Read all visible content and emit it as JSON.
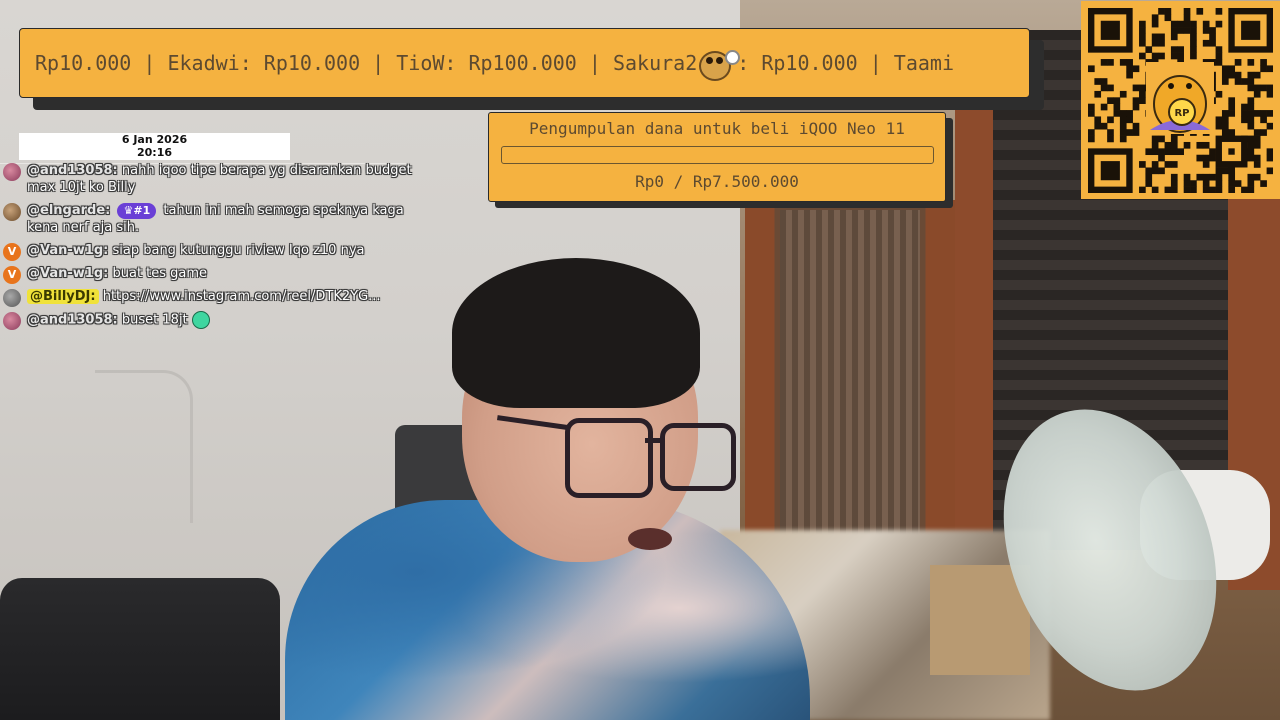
{
  "ticker": {
    "part1": "Rp10.000 | Ekadwi: Rp10.000 | TioW: Rp100.000 | Sakura2",
    "part2": ": Rp10.000 | Taami"
  },
  "timestamp": {
    "date": "6 Jan 2026",
    "time": "20:16"
  },
  "chat": [
    {
      "name": "@and13058:",
      "text": "nahh iqoo tipe berapa yg disarankan budget max 10jt ko Billy",
      "avatar": "pink"
    },
    {
      "name": "@elngarde:",
      "badge": "♛#1",
      "text": "tahun ini mah semoga speknya kaga kena nerf aja sih.",
      "avatar": "brown"
    },
    {
      "name": "@Van-w1g:",
      "text": "siap bang kutunggu riview Iqo z10 nya",
      "avatar": "orange",
      "avatar_letter": "V"
    },
    {
      "name": "@Van-w1g:",
      "text": "buat tes game",
      "avatar": "orange",
      "avatar_letter": "V"
    },
    {
      "name": "@BillyDJ:",
      "text": "https://www.instagram.com/reel/DTK2YG...",
      "avatar": "grey"
    },
    {
      "name": "@and13058:",
      "text": "buset 18jt",
      "avatar": "pink"
    }
  ],
  "donation_goal": {
    "title": "Pengumpulan dana untuk beli iQOO Neo 11",
    "amount_text": "Rp0 / Rp7.500.000",
    "progress": 0
  },
  "colors": {
    "overlay_bg": "#f5b240",
    "overlay_text": "#5d4a30",
    "shadow": "#2d2d2d"
  },
  "icons": {
    "ticker_emote": "mouse-emote-icon",
    "qr": "qr-code-icon",
    "qr_mascot_label": "RP"
  }
}
